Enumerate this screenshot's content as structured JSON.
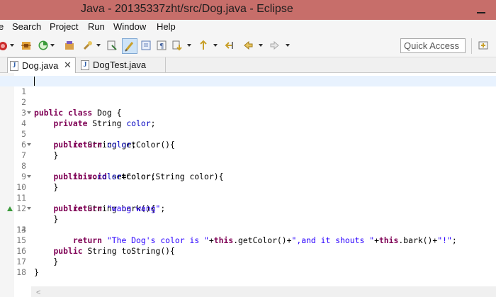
{
  "window": {
    "title": "Java - 20135337zht/src/Dog.java - Eclipse"
  },
  "menu": [
    {
      "label": "e"
    },
    {
      "label": "Search"
    },
    {
      "label": "Project"
    },
    {
      "label": "Run"
    },
    {
      "label": "Window"
    },
    {
      "label": "Help"
    }
  ],
  "toolbar": {
    "quick_access": "Quick Access",
    "icons": [
      "run-icon",
      "debug-icon",
      "coverage-icon",
      "new-package-icon",
      "search-icon",
      "toggle-mark-occurrences-icon",
      "show-whitespace-icon",
      "paragraph-icon",
      "next-annotation-icon",
      "prev-annotation-icon",
      "last-edit-icon",
      "back-icon",
      "forward-icon",
      "perspective-icon"
    ]
  },
  "tabs": [
    {
      "label": "Dog.java",
      "active": true
    },
    {
      "label": "DogTest.java",
      "active": false
    }
  ],
  "lines": [
    {
      "num": "1",
      "code": ""
    },
    {
      "num": "2",
      "code": "public class Dog {"
    },
    {
      "num": "3",
      "code": "    private String color;"
    },
    {
      "num": "4",
      "code": "    public String getColor(){"
    },
    {
      "num": "5",
      "code": "        return color;"
    },
    {
      "num": "6",
      "code": "    }"
    },
    {
      "num": "7",
      "code": "    public void setColor(String color){"
    },
    {
      "num": "8",
      "code": "        this.color=color;"
    },
    {
      "num": "9",
      "code": "    }"
    },
    {
      "num": "10",
      "code": "    public String bark(){"
    },
    {
      "num": "11",
      "code": "        return \"wang wang\";"
    },
    {
      "num": "12",
      "code": "    }"
    },
    {
      "num": "13",
      "code": "    public String toString(){"
    },
    {
      "num": "14",
      "code": "        return \"The Dog's color is \"+this.getColor()+\",and it shouts \"+this.bark()+\"!\";"
    },
    {
      "num": "15",
      "code": ""
    },
    {
      "num": "16",
      "code": "    }"
    },
    {
      "num": "17",
      "code": "}"
    },
    {
      "num": "18",
      "code": ""
    }
  ]
}
